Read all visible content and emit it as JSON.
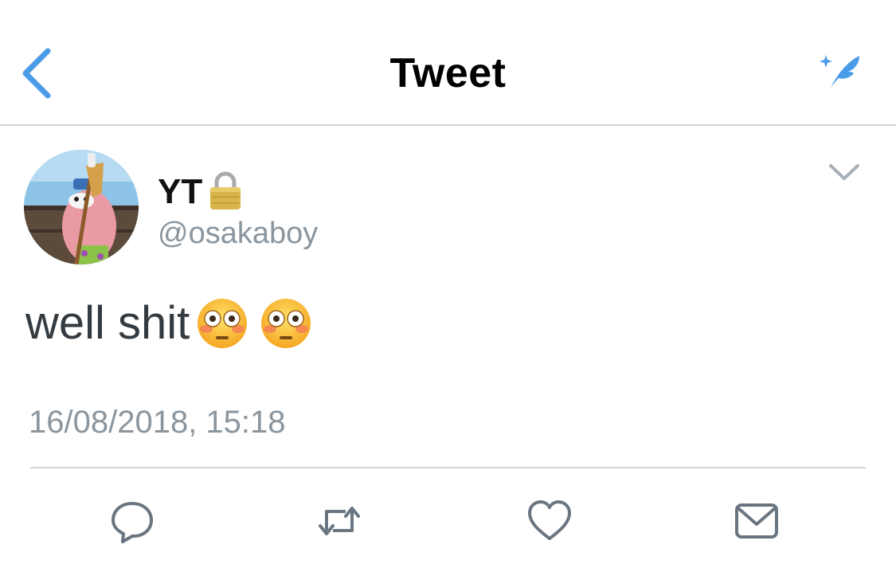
{
  "navbar": {
    "title": "Tweet",
    "back_icon": "chevron-left-icon",
    "compose_icon": "compose-tweet-icon",
    "accent_color": "#4a9be8"
  },
  "tweet": {
    "display_name": "YT",
    "protected_icon": "lock-icon",
    "handle": "@osakaboy",
    "text": "well shit",
    "emojis": [
      "flushed-face-emoji",
      "flushed-face-emoji"
    ],
    "timestamp": "16/08/2018, 15:18",
    "more_icon": "chevron-down-icon"
  },
  "actions": [
    {
      "name": "reply",
      "icon": "reply-icon"
    },
    {
      "name": "retweet",
      "icon": "retweet-icon"
    },
    {
      "name": "like",
      "icon": "heart-icon"
    },
    {
      "name": "share",
      "icon": "share-mail-icon"
    }
  ],
  "colors": {
    "text_primary": "#333a40",
    "text_secondary": "#8a959e",
    "icon_gray": "#697580",
    "divider": "#d2d5d8"
  }
}
